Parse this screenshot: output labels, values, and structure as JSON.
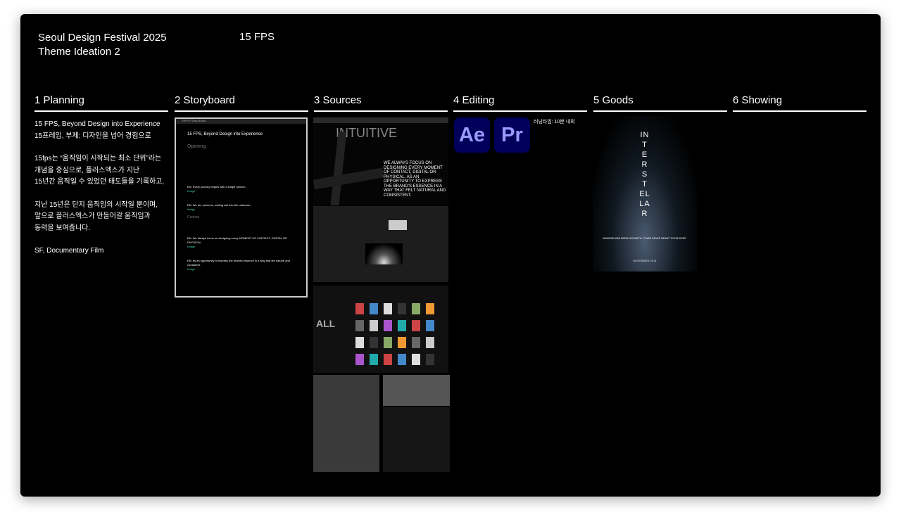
{
  "header": {
    "title_line1": "Seoul Design Festival 2025",
    "title_line2": "Theme Ideation 2",
    "fps": "15 FPS"
  },
  "columns": [
    {
      "label": "1  Planning"
    },
    {
      "label": "2  Storyboard"
    },
    {
      "label": "3  Sources"
    },
    {
      "label": "4  Editing"
    },
    {
      "label": "5  Goods"
    },
    {
      "label": "6  Showing"
    }
  ],
  "planning": {
    "p1a": "15 FPS, Beyond Design into Experience",
    "p1b": "15프레임, 부제: 디자인을 넘어 경험으로",
    "p2a": "15fps는 “움직임이 시작되는 최소 단위”라는",
    "p2b": "개념을 중심으로,  플러스엑스가 지난",
    "p2c": "15년간 움직일 수 있었던 태도들을 기록하고,",
    "p3a": "지난 15년은 단지 움직임의 시작일 뿐이며,",
    "p3b": "앞으로 플러스엑스가 만들어갈 움직임과",
    "p3c": "동력을 보여줍니다.",
    "p4": "SF, Documentary Film"
  },
  "storyboard": {
    "window_title": "15FPS Story Board",
    "title": "15 FPS, Beyond Design into Experience",
    "opening": "Opening",
    "contact": "Contact",
    "en1": "EN: Every journey begins with a single horizon.",
    "en2": "EN: We are pioneers, setting sail into the unknown.",
    "en3": "EN: We always focus on designing every MOMENT OF CONTACT, DIGITAL OR PHYSICAL.",
    "en4": "EN: as an opportunity to express the brand's essence in a way that felt natural and consistent."
  },
  "sources": {
    "s1_big": "INTUITIVE",
    "s1_text": "WE ALWAYS FOCUS ON DESIGNING EVERY MOMENT OF CONTACT, DIGITAL OR PHYSICAL. AS AN OPPORTUNITY TO EXPRESS THE BRAND'S ESSENCE IN A WAY THAT FELT NATURAL AND CONSISTENT."
  },
  "editing": {
    "apps": [
      "Ae",
      "Pr"
    ],
    "runtime": "러닝타임: 10분 내외",
    "app_bg": "#00005b",
    "app_fg": "#9999ff"
  },
  "goods": {
    "poster_title": "INTERSTELLAR",
    "tagline": "MANKIND WAS BORN ON EARTH. IT WAS NEVER MEANT TO DIE HERE.",
    "date": "NOVEMBER 2014"
  }
}
